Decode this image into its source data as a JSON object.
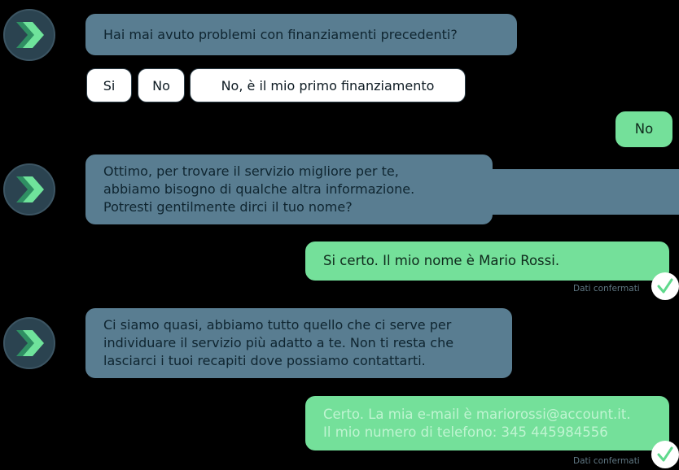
{
  "chat": {
    "bot_messages": [
      {
        "lines": [
          "Hai mai avuto problemi con finanziamenti precedenti?"
        ]
      },
      {
        "lines": [
          "Ottimo, per trovare il servizio migliore per te,",
          "abbiamo bisogno di qualche altra informazione.",
          "Potresti gentilmente dirci il tuo nome?"
        ]
      },
      {
        "lines": [
          "Ci siamo quasi, abbiamo tutto quello che ci serve per",
          "individuare il servizio più adatto a te. Non ti resta che",
          "lasciarci i tuoi recapiti dove possiamo contattarti."
        ]
      }
    ],
    "options": [
      "Si",
      "No",
      "No, è il mio primo finanziamento"
    ],
    "user_messages": [
      {
        "lines": [
          "No"
        ]
      },
      {
        "lines": [
          "Si certo. Il mio nome è Mario Rossi."
        ],
        "confirm_label": "Dati confermati"
      },
      {
        "lines": [
          "Certo. La mia e-mail è mariorossi@account.it.",
          "Il mio numero di telefono: 345 445984556"
        ],
        "confirm_label": "Dati confermati"
      }
    ]
  },
  "icons": {
    "avatar": "chevron-logo-icon",
    "check": "checkmark-icon"
  },
  "colors": {
    "bot_bubble": "#597d91",
    "user_bubble": "#74e09a",
    "avatar_bg": "#2b4350",
    "accent": "#5fd98c"
  }
}
